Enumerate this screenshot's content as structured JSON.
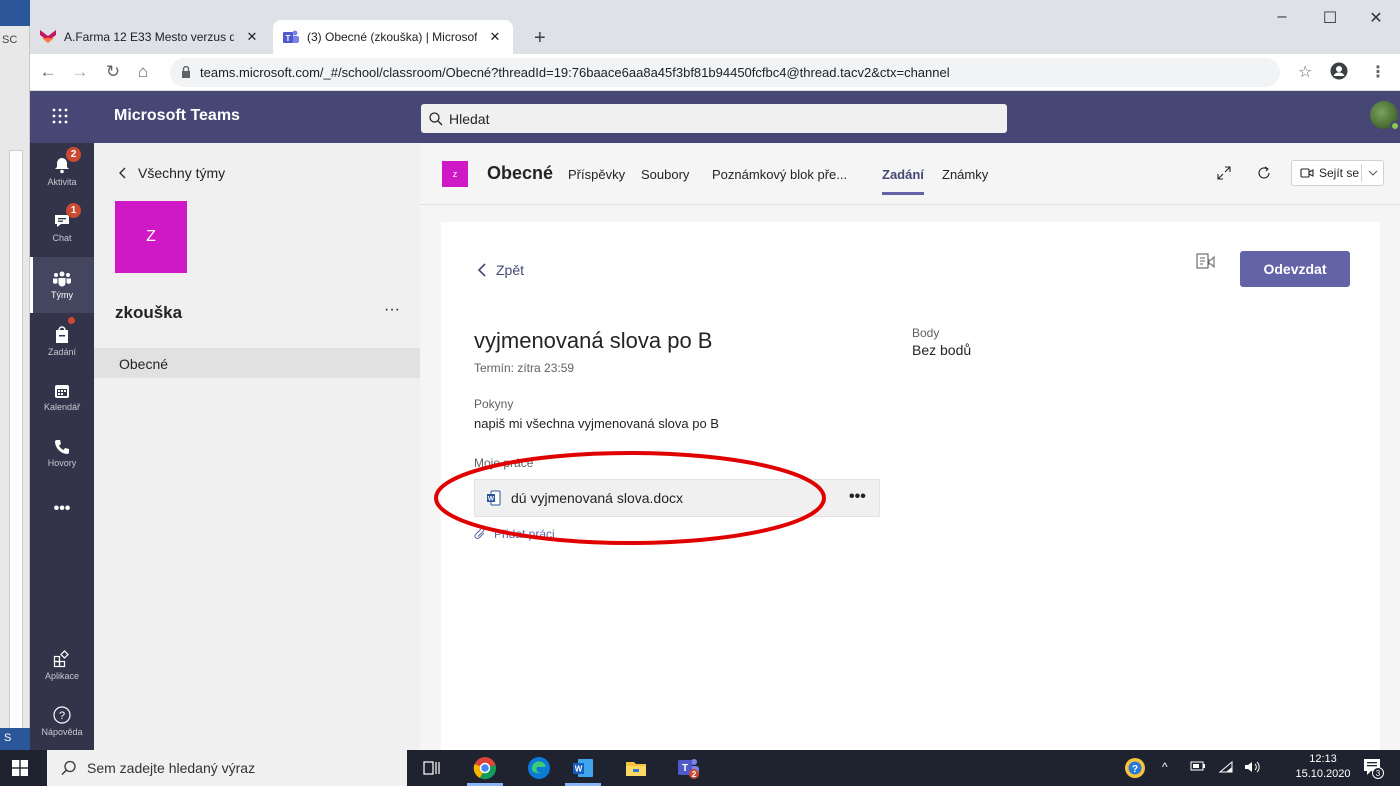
{
  "browser": {
    "tabs": [
      {
        "title": "A.Farma 12 E33 Mesto verzus dec",
        "close": "✕"
      },
      {
        "title": "(3) Obecné (zkouška) | Microsoft",
        "close": "✕"
      }
    ],
    "new_tab": "+",
    "url": "teams.microsoft.com/_#/school/classroom/Obecné?threadId=19:76baace6aa8a45f3bf81b94450fcfbc4@thread.tacv2&ctx=channel",
    "window_controls": [
      "–",
      "☐",
      "✕"
    ]
  },
  "word_strip": {
    "label": "S"
  },
  "teams": {
    "brand": "Microsoft Teams",
    "search_placeholder": "Hledat",
    "rail": [
      {
        "label": "Aktivita",
        "icon": "bell-icon",
        "badge": "2"
      },
      {
        "label": "Chat",
        "icon": "chat-icon",
        "badge": "1"
      },
      {
        "label": "Týmy",
        "icon": "teams-icon",
        "badge": ""
      },
      {
        "label": "Zadání",
        "icon": "assignments-icon",
        "badge": ""
      },
      {
        "label": "Kalendář",
        "icon": "calendar-icon",
        "badge": ""
      },
      {
        "label": "Hovory",
        "icon": "phone-icon",
        "badge": ""
      },
      {
        "label": "•••",
        "icon": "more-icon",
        "badge": ""
      },
      {
        "label": "Aplikace",
        "icon": "apps-icon",
        "badge": ""
      },
      {
        "label": "Nápověda",
        "icon": "help-icon",
        "badge": ""
      }
    ],
    "team_pane": {
      "back_label": "Všechny týmy",
      "team_initial": "Z",
      "team_name": "zkouška",
      "more": "···",
      "channels": [
        "Obecné"
      ]
    },
    "channel_header": {
      "icon_letter": "z",
      "title": "Obecné",
      "tabs": [
        "Příspěvky",
        "Soubory",
        "Poznámkový blok pře...",
        "Zadání",
        "Známky"
      ],
      "active_tab": "Zadání",
      "meet_label": "Sejít se"
    },
    "assignment": {
      "back_label": "Zpět",
      "submit_label": "Odevzdat",
      "title": "vyjmenovaná slova po B",
      "due": "Termín: zítra 23:59",
      "points_label": "Body",
      "points_value": "Bez bodů",
      "instructions_label": "Pokyny",
      "instructions_value": "napiš mi všechna vyjmenovaná slova po B",
      "my_work_label": "Moje práce",
      "file_name": "dú vyjmenovaná slova.docx",
      "file_more": "•••",
      "add_work_label": "Přidat práci"
    }
  },
  "annotation": {
    "color": "#e00000"
  },
  "taskbar": {
    "search_placeholder": "Sem zadejte hledaný výraz",
    "time": "12:13",
    "date": "15.10.2020",
    "notification_count": "3"
  },
  "colors": {
    "teams_purple": "#464775",
    "accent": "#6264a7",
    "team_tile": "#cf19c6"
  }
}
